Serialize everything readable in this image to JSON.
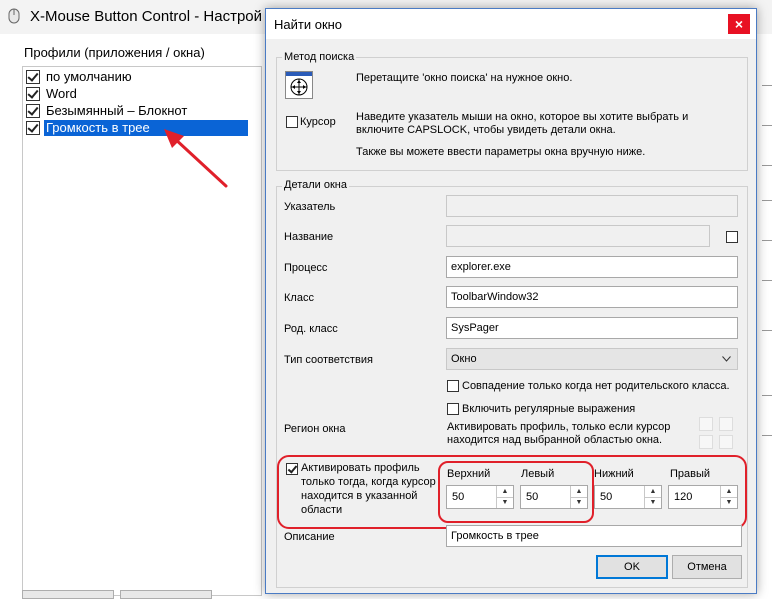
{
  "background_window": {
    "title": "X-Mouse Button Control - Настрой",
    "profiles_label": "Профили (приложения / окна)",
    "profiles": [
      {
        "label": "по умолчанию",
        "checked": true,
        "selected": false
      },
      {
        "label": "Word",
        "checked": true,
        "selected": false
      },
      {
        "label": "Безымянный – Блокнот",
        "checked": true,
        "selected": false
      },
      {
        "label": "Громкость в трее",
        "checked": true,
        "selected": true
      }
    ]
  },
  "dialog": {
    "title": "Найти окно",
    "close_icon": "×",
    "search_method": {
      "group_title": "Метод поиска",
      "drag_hint": "Перетащите 'окно поиска' на нужное окно.",
      "cursor_label": "Курсор",
      "capslock_hint_line1": "Наведите указатель мыши на окно, которое вы хотите выбрать и",
      "capslock_hint_line2": "включите CAPSLOCK, чтобы увидеть детали окна.",
      "manual_hint": "Также вы можете ввести параметры окна вручную ниже."
    },
    "details": {
      "group_title": "Детали окна",
      "pointer_label": "Указатель",
      "pointer_value": "",
      "name_label": "Название",
      "name_value": "",
      "process_label": "Процесс",
      "process_value": "explorer.exe",
      "class_label": "Класс",
      "class_value": "ToolbarWindow32",
      "parent_class_label": "Род. класс",
      "parent_class_value": "SysPager",
      "match_type_label": "Тип соответствия",
      "match_type_value": "Окно",
      "no_parent_label": "Совпадение только когда нет родительского класса.",
      "regex_label": "Включить регулярные выражения",
      "region_label": "Регион окна",
      "region_hint_line1": "Активировать профиль, только если курсор",
      "region_hint_line2": "находится над выбранной областью окна."
    },
    "activate": {
      "line1": "Активировать профиль",
      "line2": "только тогда, когда курсор",
      "line3": "находится в указанной",
      "line4": "области",
      "checked": true
    },
    "area": {
      "top_label": "Верхний",
      "top_value": "50",
      "left_label": "Левый",
      "left_value": "50",
      "bottom_label": "Нижний",
      "bottom_value": "50",
      "right_label": "Правый",
      "right_value": "120"
    },
    "description_label": "Описание",
    "description_value": "Громкость в трее",
    "ok_label": "OK",
    "cancel_label": "Отмена"
  },
  "colors": {
    "selection": "#0a64d6",
    "annotation": "#e0202a",
    "close_button": "#e81123"
  }
}
